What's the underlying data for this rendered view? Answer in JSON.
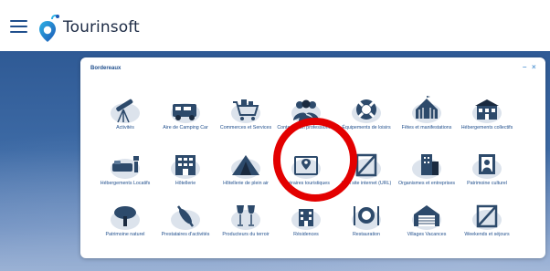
{
  "header": {
    "brand": "Tourinsoft"
  },
  "panel": {
    "title": "Bordereaux",
    "minimize": "–",
    "close": "×"
  },
  "tiles": [
    {
      "label": "Activités",
      "icon": "telescope-icon"
    },
    {
      "label": "Aire de Camping Car",
      "icon": "camper-van-icon"
    },
    {
      "label": "Commerces et Services",
      "icon": "shopping-cart-icon"
    },
    {
      "label": "Contacter un professionnel",
      "icon": "people-icon"
    },
    {
      "label": "Équipements de loisirs",
      "icon": "lifebuoy-icon"
    },
    {
      "label": "Fêtes et manifestations",
      "icon": "circus-tent-icon"
    },
    {
      "label": "Hébergements collectifs",
      "icon": "building-icon"
    },
    {
      "label": "Hébergements Locatifs",
      "icon": "bedroom-icon"
    },
    {
      "label": "Hôtellerie",
      "icon": "hotel-icon"
    },
    {
      "label": "Hôtellerie de plein air",
      "icon": "tent-icon"
    },
    {
      "label": "Itinéraires touristiques",
      "icon": "map-pin-icon"
    },
    {
      "label": "Lien site internet (URL)",
      "icon": "link-icon"
    },
    {
      "label": "Organismes et entreprises",
      "icon": "office-tower-icon"
    },
    {
      "label": "Patrimoine culturel",
      "icon": "painting-icon"
    },
    {
      "label": "Patrimoine naturel",
      "icon": "tree-icon"
    },
    {
      "label": "Prestataires d'activités",
      "icon": "kayak-icon"
    },
    {
      "label": "Producteurs du terroir",
      "icon": "wine-glasses-icon"
    },
    {
      "label": "Résidences",
      "icon": "residence-icon"
    },
    {
      "label": "Restauration",
      "icon": "plate-cutlery-icon"
    },
    {
      "label": "Villages Vacances",
      "icon": "garage-house-icon"
    },
    {
      "label": "Weekends et séjours",
      "icon": "placeholder-icon"
    }
  ],
  "colors": {
    "primary": "#1f4e8c",
    "accent": "#5b9bd5",
    "highlight": "#e30000"
  }
}
